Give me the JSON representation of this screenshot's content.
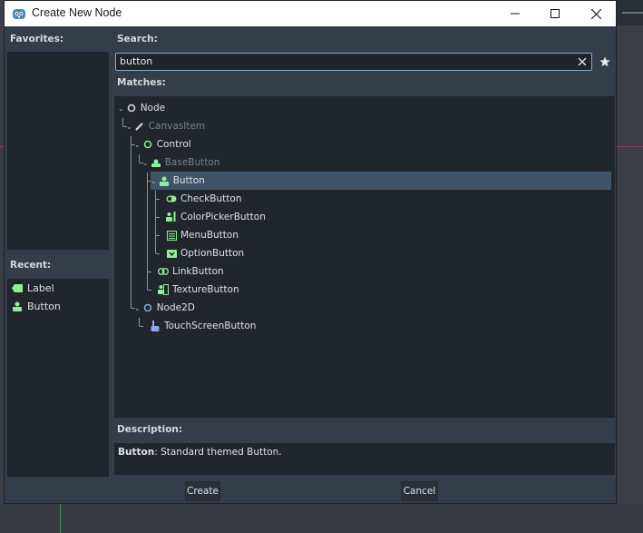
{
  "window": {
    "title": "Create New Node"
  },
  "favorites": {
    "label": "Favorites:"
  },
  "recent": {
    "label": "Recent:",
    "items": [
      {
        "label": "Label",
        "icon": "label-icon"
      },
      {
        "label": "Button",
        "icon": "button-icon"
      }
    ]
  },
  "search": {
    "label": "Search:",
    "value": "button"
  },
  "matches": {
    "label": "Matches:",
    "tree": [
      {
        "label": "Node",
        "icon": "node-icon"
      },
      {
        "label": "CanvasItem",
        "icon": "canvas-item-icon",
        "dimmed": true
      },
      {
        "label": "Control",
        "icon": "control-icon"
      },
      {
        "label": "BaseButton",
        "icon": "base-button-icon",
        "dimmed": true
      },
      {
        "label": "Button",
        "icon": "button-icon",
        "selected": true
      },
      {
        "label": "CheckButton",
        "icon": "check-button-icon"
      },
      {
        "label": "ColorPickerButton",
        "icon": "color-picker-button-icon"
      },
      {
        "label": "MenuButton",
        "icon": "menu-button-icon"
      },
      {
        "label": "OptionButton",
        "icon": "option-button-icon"
      },
      {
        "label": "LinkButton",
        "icon": "link-button-icon"
      },
      {
        "label": "TextureButton",
        "icon": "texture-button-icon"
      },
      {
        "label": "Node2D",
        "icon": "node2d-icon"
      },
      {
        "label": "TouchScreenButton",
        "icon": "touch-screen-button-icon"
      }
    ]
  },
  "description": {
    "label": "Description:",
    "class_name": "Button",
    "text": ": Standard themed Button."
  },
  "buttons": {
    "create": "Create",
    "cancel": "Cancel"
  },
  "colors": {
    "selection": "#3f5469",
    "search_border": "#7faeda",
    "control_green": "#8eef97",
    "node2d_blue": "#8da5f3"
  }
}
